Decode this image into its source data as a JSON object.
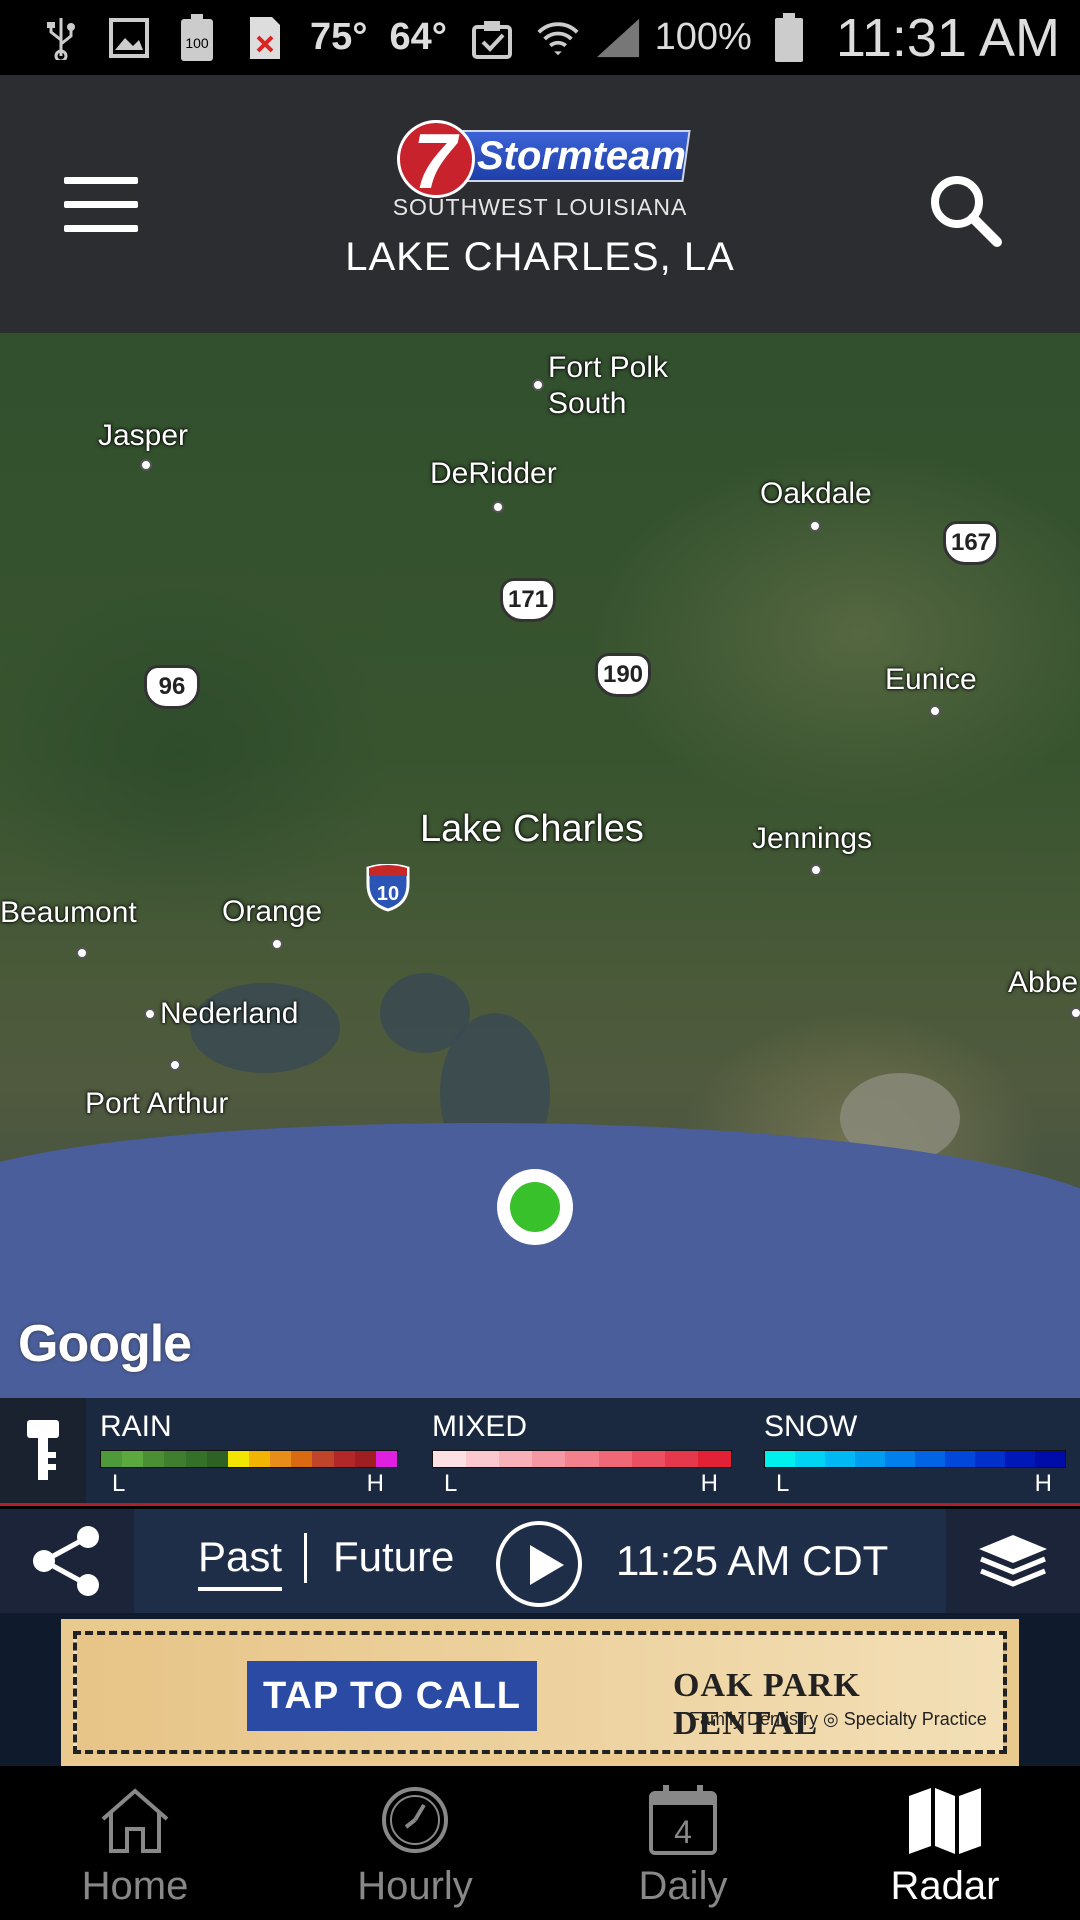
{
  "status_bar": {
    "temp_current": "75°",
    "temp_low": "64°",
    "battery_percent": "100%",
    "battery_icon_text": "100",
    "time": "11:31 AM"
  },
  "header": {
    "logo_title": "Stormteam",
    "logo_number": "7",
    "logo_subtitle": "SOUTHWEST LOUISIANA",
    "location": "LAKE CHARLES, LA"
  },
  "map": {
    "cities": [
      {
        "name": "Fort Polk"
      },
      {
        "name": "South"
      },
      {
        "name": "Jasper"
      },
      {
        "name": "DeRidder"
      },
      {
        "name": "Oakdale"
      },
      {
        "name": "Eunice"
      },
      {
        "name": "Lake Charles"
      },
      {
        "name": "Jennings"
      },
      {
        "name": "Beaumont"
      },
      {
        "name": "Orange"
      },
      {
        "name": "Abbe"
      },
      {
        "name": "Nederland"
      },
      {
        "name": "Port Arthur"
      }
    ],
    "routes": [
      "167",
      "171",
      "96",
      "190",
      "10"
    ],
    "attribution": "Google"
  },
  "legend": {
    "rain": {
      "label": "RAIN",
      "low": "L",
      "high": "H",
      "colors": [
        "#4e9a3a",
        "#5aa83e",
        "#4a8f34",
        "#3f7e2e",
        "#357028",
        "#2d6224",
        "#f2e600",
        "#f2b400",
        "#e98d1a",
        "#d86a12",
        "#c0442a",
        "#b22828",
        "#9e1e22",
        "#e020e0"
      ]
    },
    "mixed": {
      "label": "MIXED",
      "low": "L",
      "high": "H",
      "colors": [
        "#fde0e4",
        "#fbc8cf",
        "#f8b0b9",
        "#f598a3",
        "#f2808d",
        "#ee6878",
        "#ea5062",
        "#e6384c",
        "#e22036"
      ]
    },
    "snow": {
      "label": "SNOW",
      "low": "L",
      "high": "H",
      "colors": [
        "#00f0f0",
        "#00d4f4",
        "#00b8f4",
        "#009cf0",
        "#0080ec",
        "#0064e4",
        "#0048dc",
        "#0030cc",
        "#0018b8",
        "#000ca8"
      ]
    }
  },
  "controls": {
    "past_label": "Past",
    "future_label": "Future",
    "time": "11:25 AM CDT"
  },
  "ad": {
    "cta": "TAP TO CALL",
    "brand": "OAK PARK DENTAL",
    "tagline": "Family Dentistry ◎ Specialty Practice"
  },
  "nav": {
    "items": [
      {
        "label": "Home",
        "icon": "home-icon"
      },
      {
        "label": "Hourly",
        "icon": "clock-icon"
      },
      {
        "label": "Daily",
        "icon": "calendar-icon",
        "badge": "4"
      },
      {
        "label": "Radar",
        "icon": "map-icon"
      }
    ],
    "active": "Radar"
  }
}
